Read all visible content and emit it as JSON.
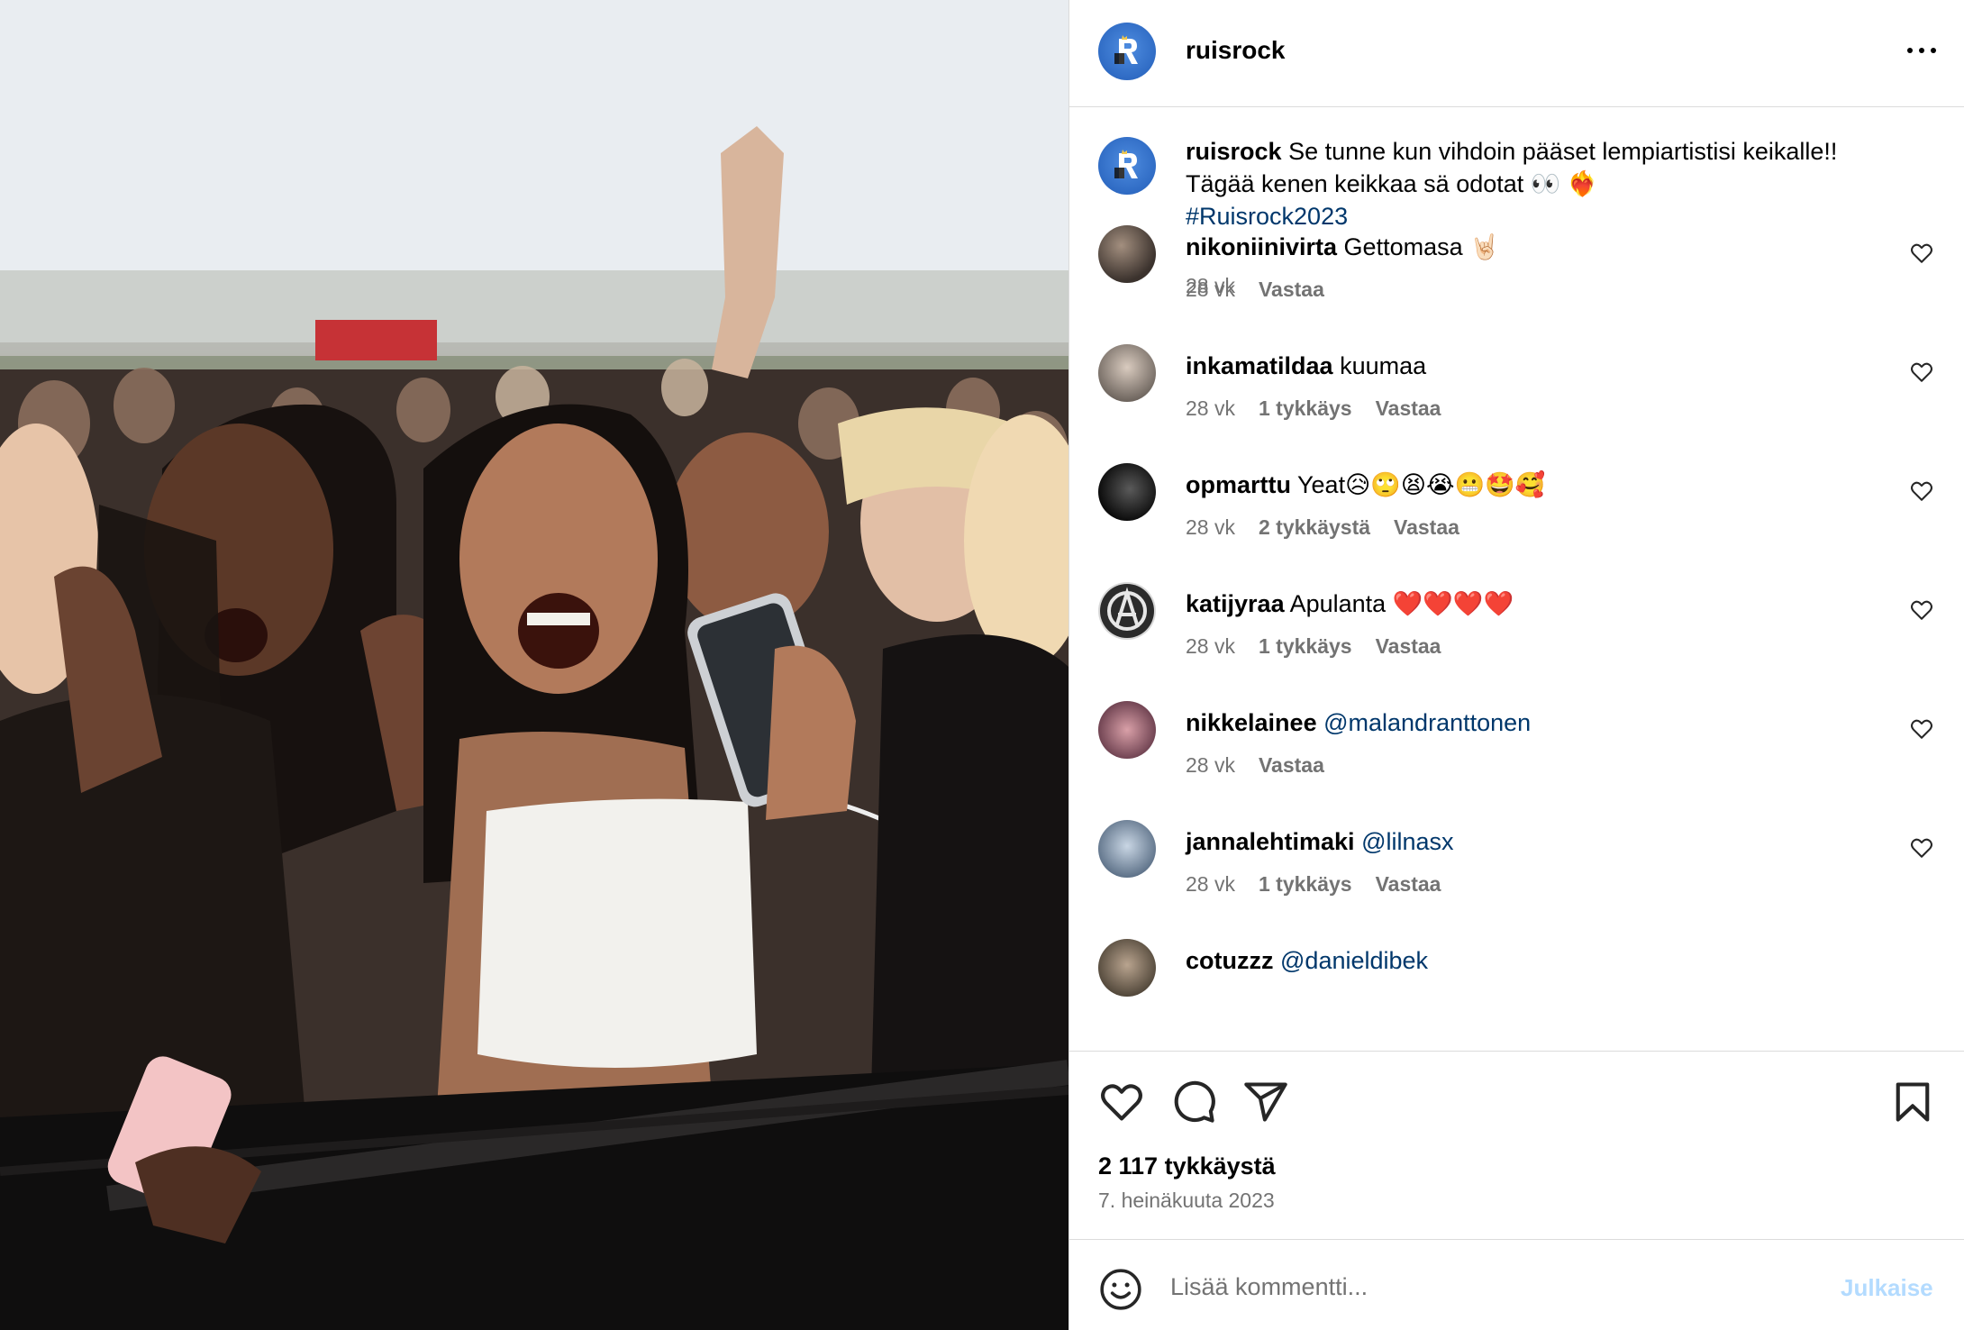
{
  "post": {
    "username": "ruisrock",
    "caption_line1": "Se tunne kun vihdoin pääset lempiartistisi keikalle!!",
    "caption_line2": "Tägää kenen keikkaa sä odotat 👀 ❤️‍🔥",
    "hashtag": "#Ruisrock2023",
    "caption_time": "28 vk"
  },
  "comments": [
    {
      "user": "nikoniinivirta",
      "text": "Gettomasa 🤘🏻",
      "time": "28 vk",
      "likes": "",
      "reply": "Vastaa"
    },
    {
      "user": "inkamatildaa",
      "text": "kuumaa",
      "time": "28 vk",
      "likes": "1 tykkäys",
      "reply": "Vastaa"
    },
    {
      "user": "opmarttu",
      "text": "Yeat😥🙄😫😭😬🤩🥰",
      "time": "28 vk",
      "likes": "2 tykkäystä",
      "reply": "Vastaa"
    },
    {
      "user": "katijyraa",
      "text": "Apulanta ❤️❤️❤️❤️",
      "time": "28 vk",
      "likes": "1 tykkäys",
      "reply": "Vastaa"
    },
    {
      "user": "nikkelainee",
      "mention": "@malandranttonen",
      "time": "28 vk",
      "likes": "",
      "reply": "Vastaa"
    },
    {
      "user": "jannalehtimaki",
      "mention": "@lilnasx",
      "time": "28 vk",
      "likes": "1 tykkäys",
      "reply": "Vastaa"
    },
    {
      "user": "cotuzzz",
      "mention": "@danieldibek"
    }
  ],
  "footer": {
    "likes": "2 117 tykkäystä",
    "date": "7. heinäkuuta 2023",
    "comment_placeholder": "Lisää kommentti...",
    "post_label": "Julkaise"
  },
  "colors": {
    "link": "#00376b",
    "muted": "#737373",
    "border": "#dbdbdb",
    "post_disabled": "#b3dbff",
    "logo_blue": "#2f6bc4"
  },
  "icons": [
    "more-icon",
    "heart-icon",
    "comment-icon",
    "share-icon",
    "bookmark-icon",
    "emoji-icon",
    "ruisrock-logo"
  ]
}
